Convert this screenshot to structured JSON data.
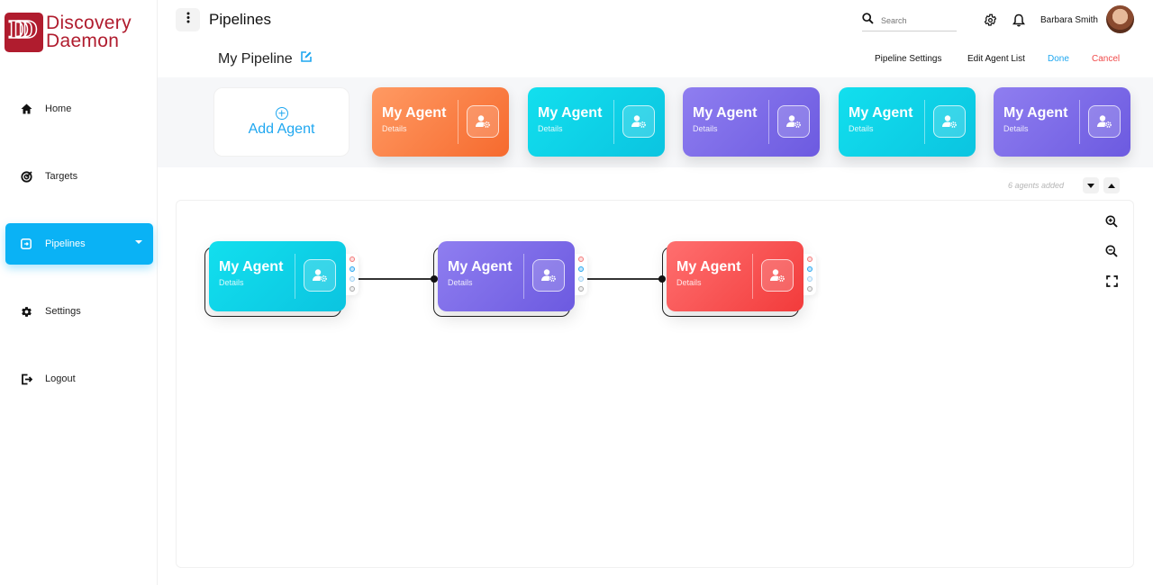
{
  "brand": {
    "line1": "Discovery",
    "line2": "Daemon",
    "mark": "DD",
    "color": "#b01c2e"
  },
  "sidebar": {
    "items": [
      {
        "label": "Home",
        "icon": "home-icon",
        "active": false
      },
      {
        "label": "Targets",
        "icon": "target-icon",
        "active": false
      },
      {
        "label": "Pipelines",
        "icon": "pipeline-icon",
        "active": true
      },
      {
        "label": "Settings",
        "icon": "gear-icon",
        "active": false
      },
      {
        "label": "Logout",
        "icon": "logout-icon",
        "active": false
      }
    ],
    "active_color": "#0ab2f5"
  },
  "header": {
    "title": "Pipelines",
    "search_placeholder": "Search",
    "user_name": "Barbara Smith"
  },
  "pipeline": {
    "name": "My Pipeline",
    "actions": {
      "settings": "Pipeline Settings",
      "edit_list": "Edit Agent List",
      "done": "Done",
      "cancel": "Cancel"
    }
  },
  "agent_strip": {
    "add_label": "Add Agent",
    "agents": [
      {
        "title": "My Agent",
        "subtitle": "Details",
        "color": "orange"
      },
      {
        "title": "My Agent",
        "subtitle": "Details",
        "color": "cyan"
      },
      {
        "title": "My Agent",
        "subtitle": "Details",
        "color": "purple"
      },
      {
        "title": "My Agent",
        "subtitle": "Details",
        "color": "cyan"
      },
      {
        "title": "My Agent",
        "subtitle": "Details",
        "color": "purple"
      }
    ],
    "count_text": "6 agents added"
  },
  "canvas": {
    "nodes": [
      {
        "title": "My Agent",
        "subtitle": "Details",
        "color": "cyan"
      },
      {
        "title": "My Agent",
        "subtitle": "Details",
        "color": "purple"
      },
      {
        "title": "My Agent",
        "subtitle": "Details",
        "color": "red"
      }
    ],
    "tools": [
      "zoom-in-icon",
      "zoom-out-icon",
      "fullscreen-icon"
    ]
  },
  "colors": {
    "orange": "#f66a2e",
    "cyan": "#0bc4e0",
    "purple": "#6c5ae0",
    "red": "#f23b3b",
    "done": "#1fa7f0",
    "cancel": "#f04a4a"
  }
}
